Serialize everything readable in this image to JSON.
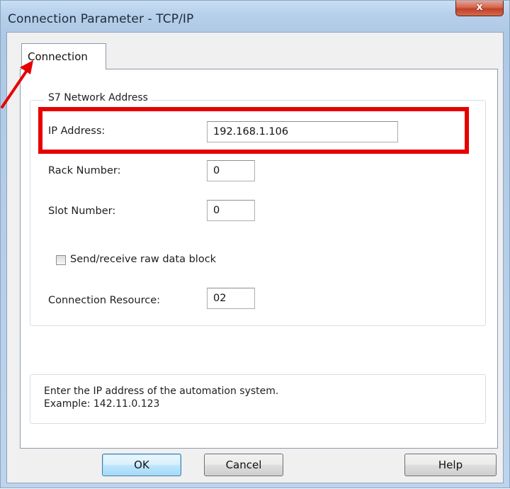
{
  "window": {
    "title": "Connection Parameter - TCP/IP",
    "close_glyph": "x"
  },
  "tabs": [
    {
      "label": "Connection",
      "selected": true
    }
  ],
  "group": {
    "legend": "S7 Network Address"
  },
  "fields": {
    "ip_address": {
      "label": "IP Address:",
      "value": "192.168.1.106"
    },
    "rack_number": {
      "label": "Rack Number:",
      "value": "0"
    },
    "slot_number": {
      "label": "Slot Number:",
      "value": "0"
    },
    "raw_data_block": {
      "label": "Send/receive raw data block",
      "checked": false
    },
    "connection_resource": {
      "label": "Connection Resource:",
      "value": "02"
    }
  },
  "info": {
    "line1": "Enter the IP address of the automation system.",
    "line2": "Example: 142.11.0.123"
  },
  "buttons": {
    "ok": "OK",
    "cancel": "Cancel",
    "help": "Help"
  },
  "annotation": {
    "highlight_color": "#e60000",
    "arrow_color": "#e60000"
  },
  "icons": {
    "close": "close-icon",
    "arrow": "annotation-arrow-icon"
  }
}
